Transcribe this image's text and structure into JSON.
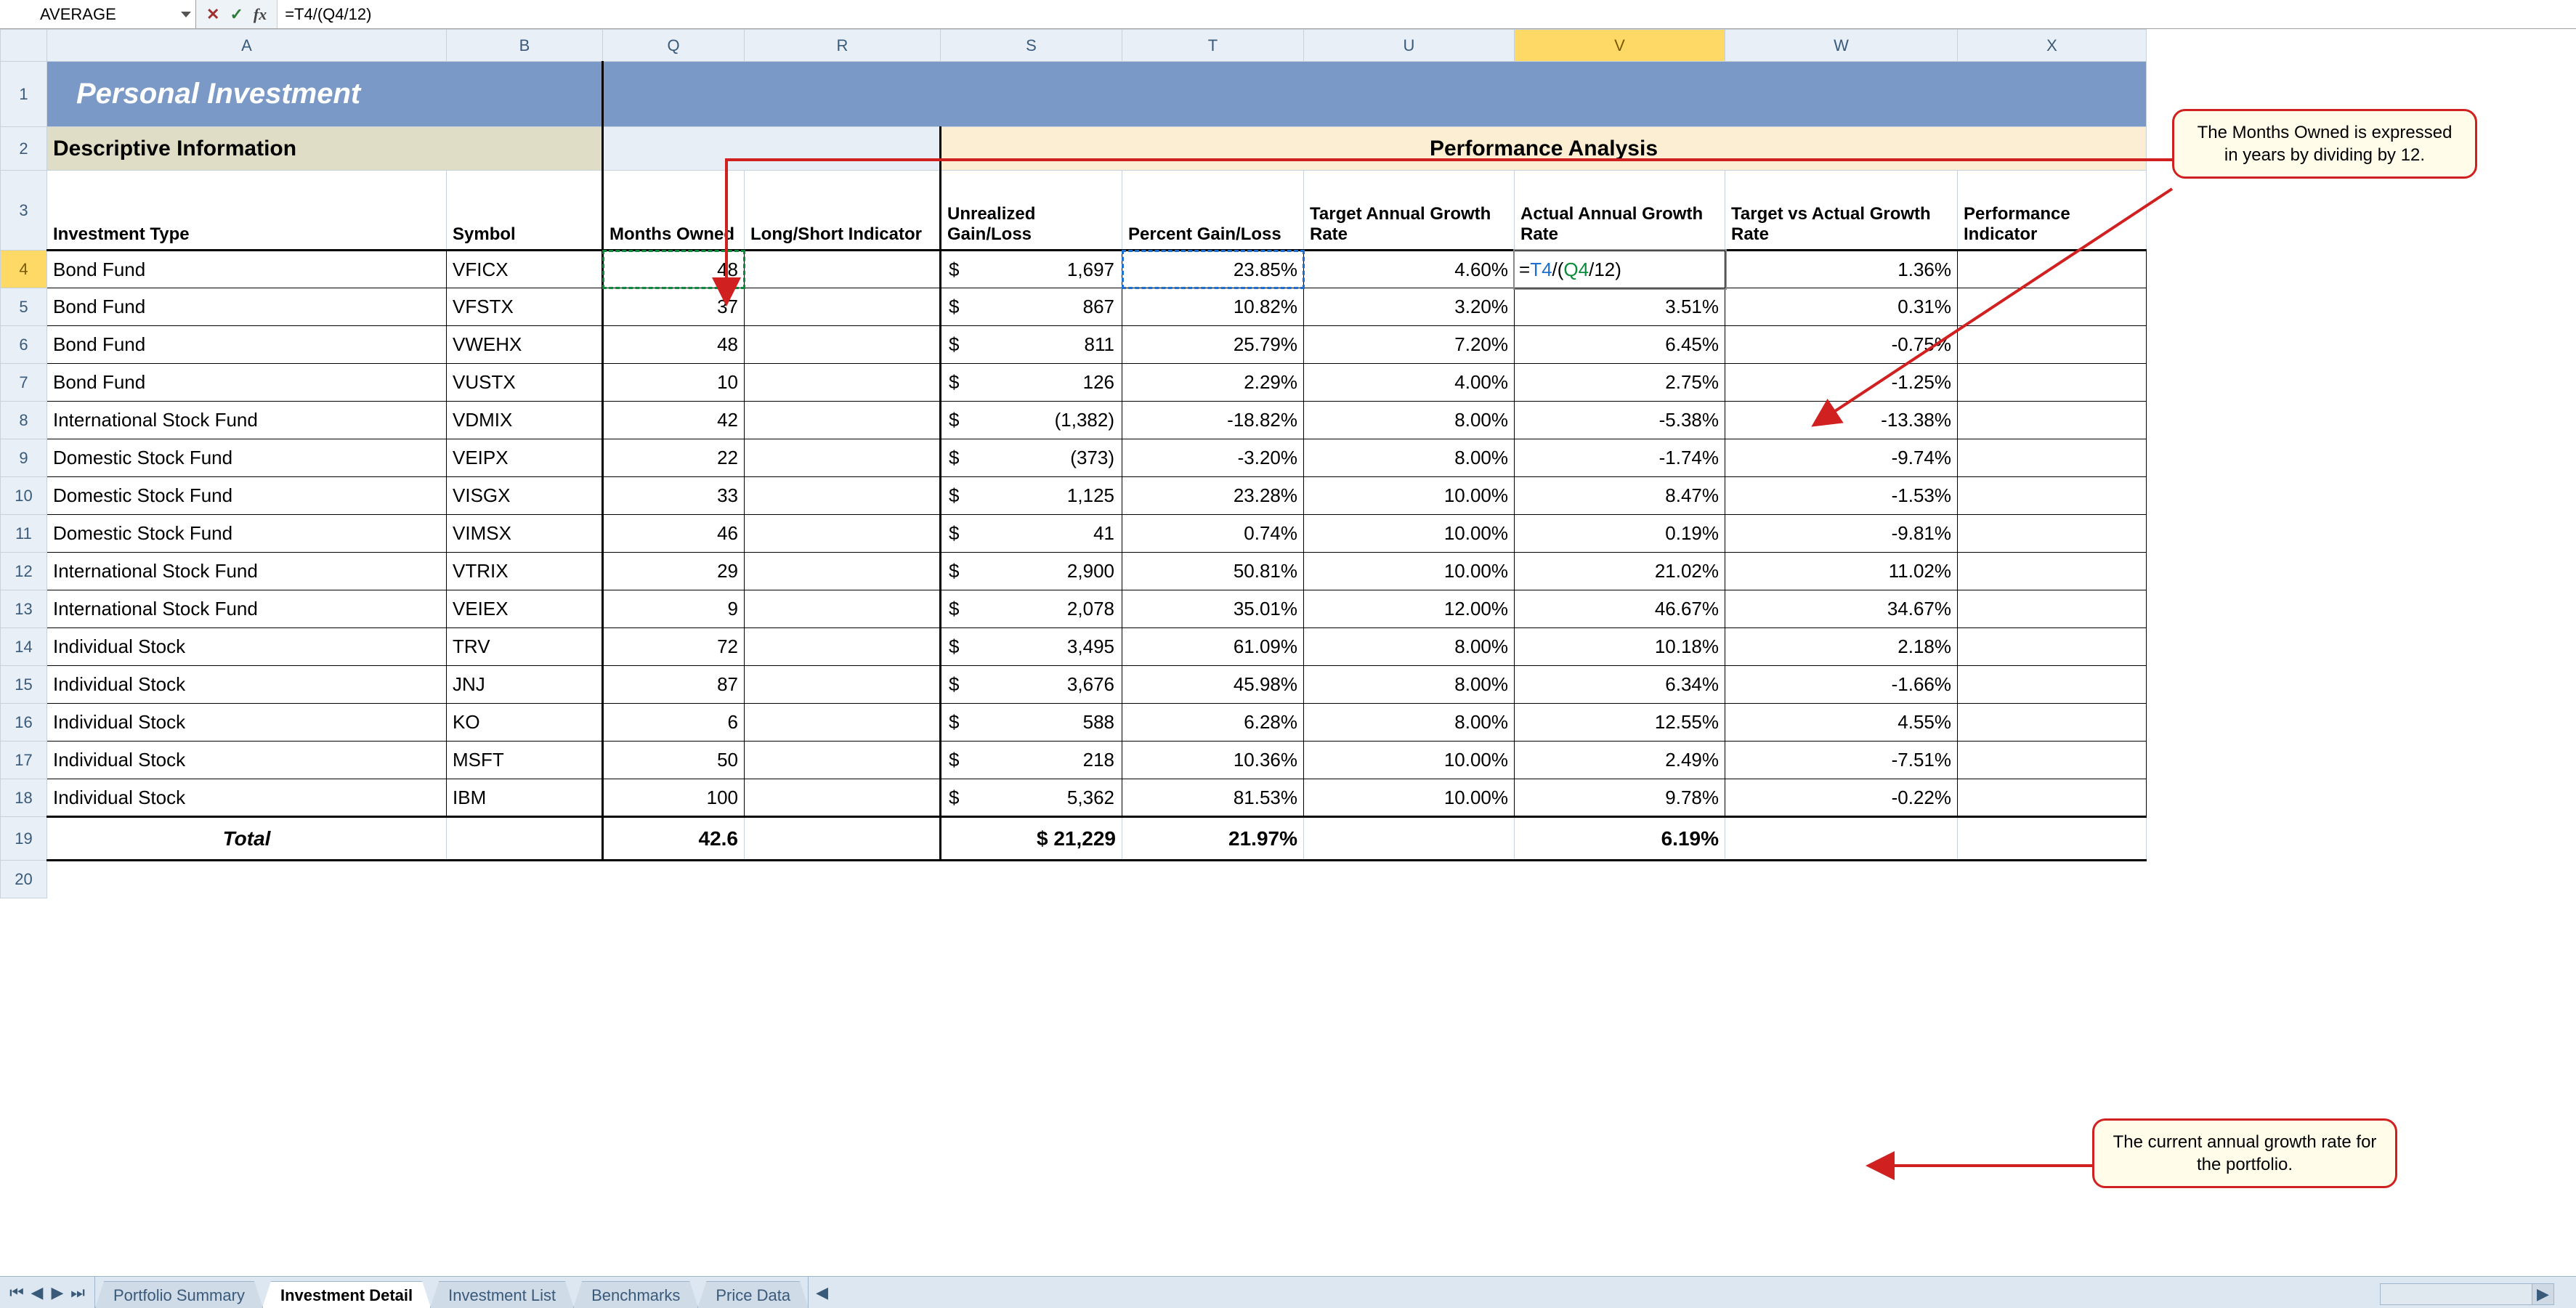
{
  "formula_bar": {
    "name_box": "AVERAGE",
    "cancel": "✕",
    "enter": "✓",
    "fx": "fx",
    "formula": "=T4/(Q4/12)"
  },
  "columns": [
    "",
    "A",
    "B",
    "Q",
    "R",
    "S",
    "T",
    "U",
    "V",
    "W",
    "X"
  ],
  "active_col": "V",
  "active_row": "4",
  "title": "Personal Investment",
  "sections": {
    "descriptive": "Descriptive Information",
    "performance": "Performance Analysis"
  },
  "headers": {
    "A": "Investment Type",
    "B": "Symbol",
    "Q": "Months Owned",
    "R": "Long/Short Indicator",
    "S": "Unrealized Gain/Loss",
    "T": "Percent Gain/Loss",
    "U": "Target Annual Growth Rate",
    "V": "Actual Annual Growth Rate",
    "W": "Target vs Actual Growth Rate",
    "X": "Performance Indicator"
  },
  "editing_formula": "=T4/(Q4/12)",
  "rows": [
    {
      "n": "4",
      "A": "Bond Fund",
      "B": "VFICX",
      "Q": "48",
      "R": "",
      "S": "1,697",
      "T": "23.85%",
      "U": "4.60%",
      "V": "=T4/(Q4/12)",
      "W": "1.36%",
      "X": ""
    },
    {
      "n": "5",
      "A": "Bond Fund",
      "B": "VFSTX",
      "Q": "37",
      "R": "",
      "S": "867",
      "T": "10.82%",
      "U": "3.20%",
      "V": "3.51%",
      "W": "0.31%",
      "X": ""
    },
    {
      "n": "6",
      "A": "Bond Fund",
      "B": "VWEHX",
      "Q": "48",
      "R": "",
      "S": "811",
      "T": "25.79%",
      "U": "7.20%",
      "V": "6.45%",
      "W": "-0.75%",
      "X": ""
    },
    {
      "n": "7",
      "A": "Bond Fund",
      "B": "VUSTX",
      "Q": "10",
      "R": "",
      "S": "126",
      "T": "2.29%",
      "U": "4.00%",
      "V": "2.75%",
      "W": "-1.25%",
      "X": ""
    },
    {
      "n": "8",
      "A": "International Stock Fund",
      "B": "VDMIX",
      "Q": "42",
      "R": "",
      "S": "(1,382)",
      "T": "-18.82%",
      "U": "8.00%",
      "V": "-5.38%",
      "W": "-13.38%",
      "X": ""
    },
    {
      "n": "9",
      "A": "Domestic Stock Fund",
      "B": "VEIPX",
      "Q": "22",
      "R": "",
      "S": "(373)",
      "T": "-3.20%",
      "U": "8.00%",
      "V": "-1.74%",
      "W": "-9.74%",
      "X": ""
    },
    {
      "n": "10",
      "A": "Domestic Stock Fund",
      "B": "VISGX",
      "Q": "33",
      "R": "",
      "S": "1,125",
      "T": "23.28%",
      "U": "10.00%",
      "V": "8.47%",
      "W": "-1.53%",
      "X": ""
    },
    {
      "n": "11",
      "A": "Domestic Stock Fund",
      "B": "VIMSX",
      "Q": "46",
      "R": "",
      "S": "41",
      "T": "0.74%",
      "U": "10.00%",
      "V": "0.19%",
      "W": "-9.81%",
      "X": ""
    },
    {
      "n": "12",
      "A": "International Stock Fund",
      "B": "VTRIX",
      "Q": "29",
      "R": "",
      "S": "2,900",
      "T": "50.81%",
      "U": "10.00%",
      "V": "21.02%",
      "W": "11.02%",
      "X": ""
    },
    {
      "n": "13",
      "A": "International Stock Fund",
      "B": "VEIEX",
      "Q": "9",
      "R": "",
      "S": "2,078",
      "T": "35.01%",
      "U": "12.00%",
      "V": "46.67%",
      "W": "34.67%",
      "X": ""
    },
    {
      "n": "14",
      "A": "Individual Stock",
      "B": "TRV",
      "Q": "72",
      "R": "",
      "S": "3,495",
      "T": "61.09%",
      "U": "8.00%",
      "V": "10.18%",
      "W": "2.18%",
      "X": ""
    },
    {
      "n": "15",
      "A": "Individual Stock",
      "B": "JNJ",
      "Q": "87",
      "R": "",
      "S": "3,676",
      "T": "45.98%",
      "U": "8.00%",
      "V": "6.34%",
      "W": "-1.66%",
      "X": ""
    },
    {
      "n": "16",
      "A": "Individual Stock",
      "B": "KO",
      "Q": "6",
      "R": "",
      "S": "588",
      "T": "6.28%",
      "U": "8.00%",
      "V": "12.55%",
      "W": "4.55%",
      "X": ""
    },
    {
      "n": "17",
      "A": "Individual Stock",
      "B": "MSFT",
      "Q": "50",
      "R": "",
      "S": "218",
      "T": "10.36%",
      "U": "10.00%",
      "V": "2.49%",
      "W": "-7.51%",
      "X": ""
    },
    {
      "n": "18",
      "A": "Individual Stock",
      "B": "IBM",
      "Q": "100",
      "R": "",
      "S": "5,362",
      "T": "81.53%",
      "U": "10.00%",
      "V": "9.78%",
      "W": "-0.22%",
      "X": ""
    }
  ],
  "total": {
    "label": "Total",
    "Q": "42.6",
    "S": "$ 21,229",
    "T": "21.97%",
    "V": "6.19%"
  },
  "callouts": {
    "top": "The Months Owned is expressed in years by dividing by 12.",
    "bottom": "The current annual growth rate for the portfolio."
  },
  "tabs": [
    "Portfolio Summary",
    "Investment Detail",
    "Investment List",
    "Benchmarks",
    "Price Data"
  ],
  "active_tab": "Investment Detail",
  "row_after_total": "19",
  "row_last": "20"
}
